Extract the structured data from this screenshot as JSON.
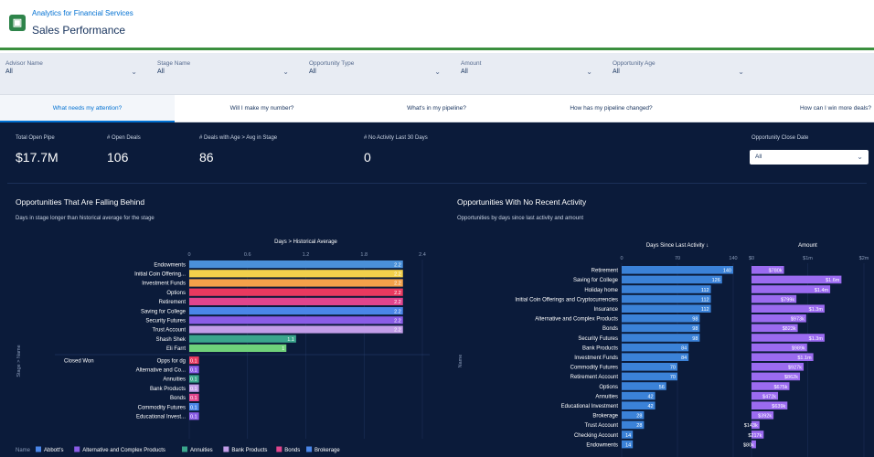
{
  "header": {
    "subtitle": "Analytics for Financial Services",
    "title": "Sales Performance",
    "icon": "building-icon"
  },
  "filters": [
    {
      "label": "Advisor Name",
      "value": "All"
    },
    {
      "label": "Stage Name",
      "value": "All"
    },
    {
      "label": "Opportunity Type",
      "value": "All"
    },
    {
      "label": "Amount",
      "value": "All"
    },
    {
      "label": "Opportunity Age",
      "value": "All"
    }
  ],
  "tabs": [
    {
      "label": "What needs my attention?",
      "active": true
    },
    {
      "label": "Will I make my number?"
    },
    {
      "label": "What's in my pipeline?"
    },
    {
      "label": "How has my pipeline changed?"
    },
    {
      "label": "How can I win more deals?"
    }
  ],
  "kpis": [
    {
      "label": "Total Open Pipe",
      "value": "$17.7M"
    },
    {
      "label": "# Open Deals",
      "value": "106"
    },
    {
      "label": "# Deals with Age > Avg in Stage",
      "value": "86"
    },
    {
      "label": "# No Activity Last 30 Days",
      "value": "0"
    }
  ],
  "close_date": {
    "label": "Opportunity Close Date",
    "value": "All"
  },
  "left_section": {
    "title": "Opportunities That Are Falling Behind",
    "subtitle": "Days in stage longer than historical average for the stage"
  },
  "right_section": {
    "title": "Opportunities With No Recent Activity",
    "subtitle": "Opportunities by days since last activity and amount"
  },
  "colors": {
    "dark_bg": "#0b1b3a",
    "accent_blue": "#0070d2",
    "green": "#3b8f3e"
  },
  "chart_data": [
    {
      "type": "bar",
      "orientation": "horizontal",
      "title": "Days > Historical Average",
      "ylabel": "Stage > Name",
      "xlim": [
        0,
        2.4
      ],
      "ticks": [
        "0",
        "0.6",
        "1.2",
        "1.8",
        "2.4"
      ],
      "groups": [
        {
          "name": "",
          "rows": [
            {
              "label": "Endowments",
              "value": 2.2,
              "display": "2.2",
              "color": "#4a90d9"
            },
            {
              "label": "Initial Coin Offering...",
              "value": 2.2,
              "display": "2.2",
              "color": "#f2d04b"
            },
            {
              "label": "Investment Funds",
              "value": 2.2,
              "display": "2.2",
              "color": "#f4a14a"
            },
            {
              "label": "Options",
              "value": 2.2,
              "display": "2.2",
              "color": "#e8395f"
            },
            {
              "label": "Retirement",
              "value": 2.2,
              "display": "2.2",
              "color": "#e0458d"
            },
            {
              "label": "Saving for College",
              "value": 2.2,
              "display": "2.2",
              "color": "#4a86e8"
            },
            {
              "label": "Security Futures",
              "value": 2.2,
              "display": "2.2",
              "color": "#8a5ce6"
            },
            {
              "label": "Trust Account",
              "value": 2.2,
              "display": "2.2",
              "color": "#c29de8"
            },
            {
              "label": "Shash Shek",
              "value": 1.1,
              "display": "1.1",
              "color": "#3aa68c"
            },
            {
              "label": "Eli Farrt",
              "value": 1,
              "display": "1",
              "color": "#6fd17a"
            }
          ]
        },
        {
          "name": "Closed Won",
          "rows": [
            {
              "label": "Opps for dg",
              "value": 0.1,
              "display": "0.1",
              "color": "#e8395f"
            },
            {
              "label": "Alternative and Co...",
              "value": 0.1,
              "display": "0.1",
              "color": "#8a5ce6"
            },
            {
              "label": "Annuities",
              "value": 0.1,
              "display": "0.1",
              "color": "#3aa68c"
            },
            {
              "label": "Bank Products",
              "value": 0.1,
              "display": "0.1",
              "color": "#c29de8"
            },
            {
              "label": "Bonds",
              "value": 0.1,
              "display": "0.1",
              "color": "#e0458d"
            },
            {
              "label": "Commodity Futures",
              "value": 0.1,
              "display": "0.1",
              "color": "#4a86e8"
            },
            {
              "label": "Educational Invest...",
              "value": 0.1,
              "display": "0.1",
              "color": "#8a5ce6"
            }
          ]
        }
      ],
      "legend": {
        "title": "Name",
        "items": [
          {
            "label": "Abbott's",
            "color": "#4a86e8"
          },
          {
            "label": "Alternative and Complex Products",
            "color": "#8a5ce6"
          },
          {
            "label": "Annuities",
            "color": "#3aa68c"
          },
          {
            "label": "Bank Products",
            "color": "#c29de8"
          },
          {
            "label": "Bonds",
            "color": "#e0458d"
          },
          {
            "label": "Brokerage",
            "color": "#4a86e8"
          }
        ]
      }
    },
    {
      "type": "bar",
      "orientation": "horizontal",
      "ylabel": "Name",
      "categories": [
        "Retirement",
        "Saving for College",
        "Holiday home",
        "Initial Coin Offerings and Cryptocurrencies",
        "Insurance",
        "Alternative and Complex Products",
        "Bonds",
        "Security Futures",
        "Bank Products",
        "Investment Funds",
        "Commodity Futures",
        "Retirement Account",
        "Options",
        "Annuities",
        "Educational Investment",
        "Brokerage",
        "Trust Account",
        "Checking Account",
        "Endowments"
      ],
      "series": [
        {
          "name": "Days Since Last Activity",
          "xlim": [
            0,
            140
          ],
          "ticks": [
            "0",
            "70",
            "140"
          ],
          "values": [
            140,
            126,
            112,
            112,
            112,
            98,
            98,
            98,
            84,
            84,
            70,
            70,
            56,
            42,
            42,
            28,
            28,
            14,
            14
          ],
          "labels": [
            "140",
            "126",
            "112",
            "112",
            "112",
            "98",
            "98",
            "98",
            "84",
            "84",
            "70",
            "70",
            "56",
            "42",
            "42",
            "28",
            "28",
            "14",
            "14"
          ],
          "color": "#3b82d8"
        },
        {
          "name": "Amount",
          "xlim": [
            0,
            2
          ],
          "ticks": [
            "$0",
            "$1m",
            "$2m"
          ],
          "values": [
            0.579,
            1.6,
            1.4,
            0.799,
            1.3,
            0.973,
            0.823,
            1.3,
            0.989,
            1.1,
            0.927,
            0.862,
            0.675,
            0.472,
            0.639,
            0.392,
            0.143,
            0.217,
            0.08
          ],
          "labels": [
            "$780k",
            "$1.6m",
            "$1.4m",
            "$799k",
            "$1.3m",
            "$973k",
            "$823k",
            "$1.3m",
            "$989k",
            "$1.1m",
            "$927k",
            "$862k",
            "$675k",
            "$472k",
            "$639k",
            "$392k",
            "$143k",
            "$217k",
            "$80k"
          ],
          "color": "#9b6bf0"
        }
      ]
    }
  ]
}
